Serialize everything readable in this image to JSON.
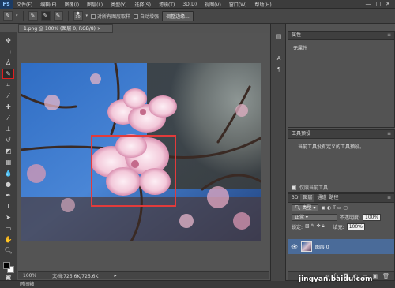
{
  "app": {
    "logo": "Ps",
    "menu": [
      "文件(F)",
      "编辑(E)",
      "图像(I)",
      "图层(L)",
      "类型(Y)",
      "选择(S)",
      "滤镜(T)",
      "3D(D)",
      "视图(V)",
      "窗口(W)",
      "帮助(H)"
    ],
    "window_buttons": [
      "—",
      "□",
      "✕"
    ]
  },
  "options": {
    "brush_size": "30",
    "sample_all_layers": "对所有图层取样",
    "auto_enhance": "自动增强",
    "refine_edge": "调整边缘..."
  },
  "document": {
    "tab_title": "1.png @ 100% (图层 0, RGB/8) ×",
    "zoom": "100%",
    "doc_size": "文档:725.6K/725.6K"
  },
  "bottom_tab": "时间轴",
  "panels": {
    "properties": {
      "title": "属性",
      "empty_text": "无属性"
    },
    "tool_presets": {
      "title": "工具预设",
      "message": "当前工具没有定义的工具预设。",
      "current_tool_only": "仅限当前工具"
    },
    "layers": {
      "tabs": [
        "3D",
        "图层",
        "通道",
        "路径"
      ],
      "kind_filter": "类型",
      "blend_mode": "正常",
      "opacity_label": "不透明度:",
      "opacity_value": "100%",
      "lock_label": "锁定:",
      "fill_label": "填充:",
      "fill_value": "100%",
      "layer_name": "图层 0"
    }
  },
  "watermark": "jingyan.baidu.com",
  "colors": {
    "accent": "#e02020",
    "selection_box": "#e23b3b",
    "layer_selected": "#4a6b99"
  }
}
